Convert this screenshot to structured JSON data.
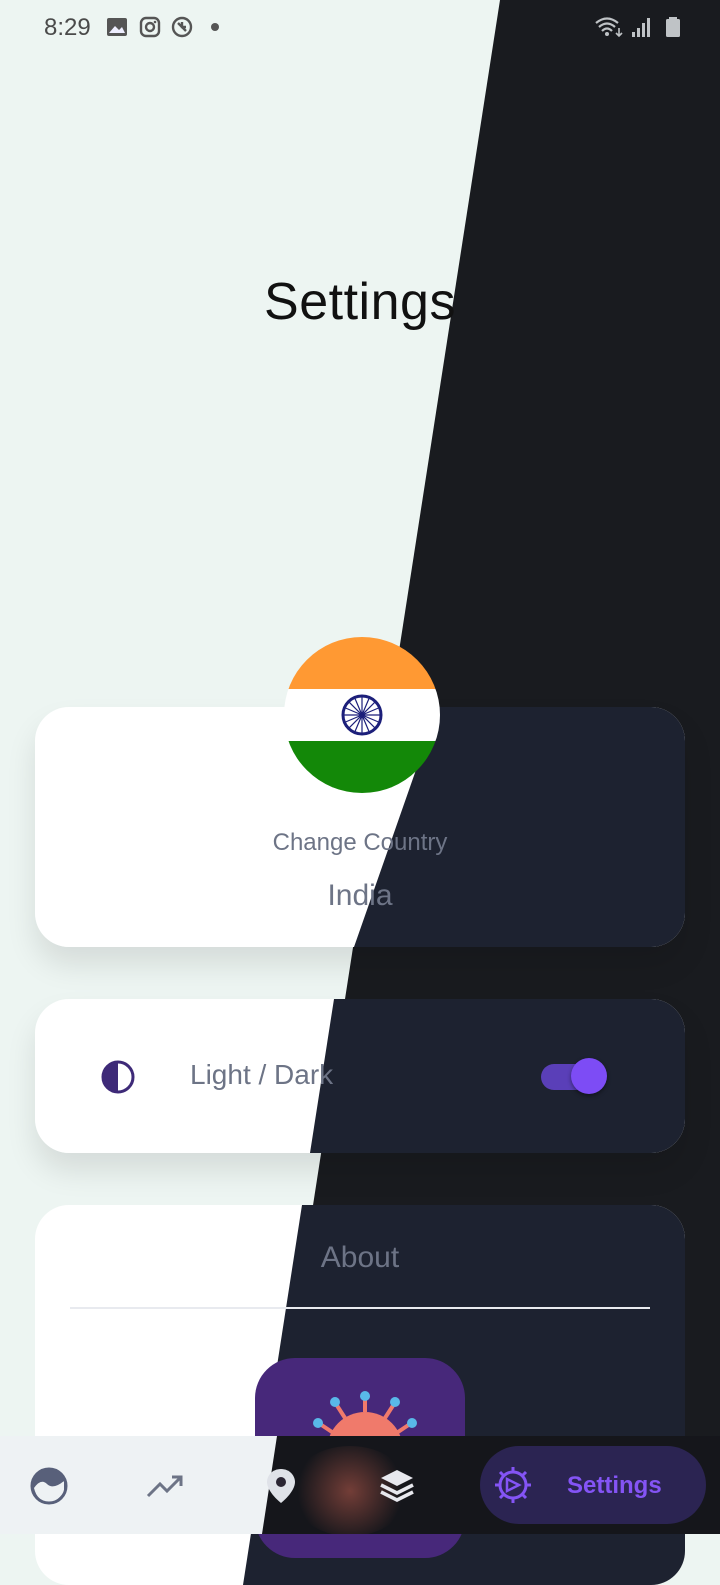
{
  "status_bar": {
    "time": "8:29",
    "left_icons": [
      "gallery-icon",
      "instagram-icon",
      "vpn-icon",
      "dot-icon"
    ],
    "right_icons": [
      "wifi-icon",
      "signal-icon",
      "battery-icon"
    ]
  },
  "page": {
    "title": "Settings"
  },
  "country_card": {
    "label": "Change Country",
    "value": "India",
    "flag": "india-flag"
  },
  "theme_card": {
    "label": "Light / Dark",
    "toggle_on": true
  },
  "about_card": {
    "title": "About"
  },
  "bottom_nav": {
    "items": [
      {
        "name": "home",
        "icon": "globe-icon"
      },
      {
        "name": "trends",
        "icon": "trending-icon"
      },
      {
        "name": "location",
        "icon": "location-pin-icon"
      },
      {
        "name": "layers",
        "icon": "layers-icon"
      },
      {
        "name": "settings",
        "icon": "settings-gear-icon",
        "label": "Settings",
        "active": true
      }
    ]
  },
  "colors": {
    "light_bg": "#edf5f2",
    "dark_bg": "#191b1f",
    "accent": "#7d4cf5",
    "text_muted": "#6d7486"
  }
}
